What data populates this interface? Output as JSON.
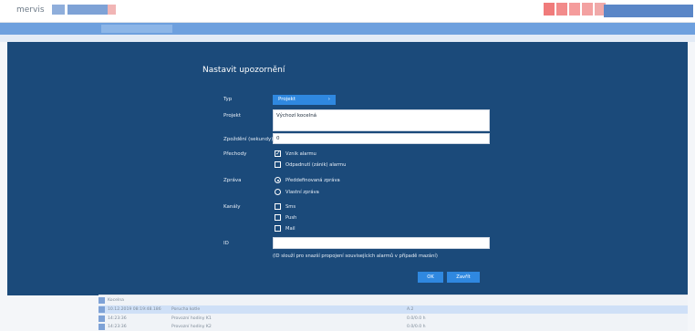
{
  "app": {
    "logo": "mervis"
  },
  "modal": {
    "title": "Nastavit upozornění",
    "fields": {
      "typ": {
        "label": "Typ",
        "value": "Projekt",
        "chevron": "›"
      },
      "projekt": {
        "label": "Projekt",
        "value": "Výchozí kocelná"
      },
      "zpozdeni": {
        "label": "Zpoždění (sekundy)",
        "value": "0"
      },
      "prechody": {
        "label": "Přechody",
        "options": [
          {
            "label": "Vznik alarmu",
            "checked": true
          },
          {
            "label": "Odpadnutí (zánik) alarmu",
            "checked": false
          }
        ]
      },
      "zprava": {
        "label": "Zpráva",
        "options": [
          {
            "label": "Předdefinovaná zpráva",
            "selected": true
          },
          {
            "label": "Vlastní zpráva",
            "selected": false
          }
        ]
      },
      "kanaly": {
        "label": "Kanály",
        "options": [
          {
            "label": "Sms",
            "checked": false
          },
          {
            "label": "Push",
            "checked": false
          },
          {
            "label": "Mail",
            "checked": false
          }
        ]
      },
      "id": {
        "label": "ID",
        "value": "",
        "note": "(ID slouží pro snazší propojení souvisejících alarmů v případě mazání)"
      }
    },
    "buttons": {
      "ok": "OK",
      "close": "Zavřít"
    }
  },
  "background_table": {
    "rows": [
      {
        "col1": "Kocelna",
        "col2": "",
        "col3": ""
      },
      {
        "col1": "10.12.2019 08:19:48.186",
        "col2": "Porucha kotle",
        "col3": "A.2"
      },
      {
        "col1": "14:23:36",
        "col2": "Provozní hodiny K1",
        "col3": "0.0/0.0 h"
      },
      {
        "col1": "14:23:36",
        "col2": "Provozní hodiny K2",
        "col3": "0.0/0.0 h"
      }
    ]
  },
  "colors": {
    "modal_bg": "#1b4a7a",
    "accent": "#2f88e0",
    "toolbar": "#6ea0de"
  },
  "icons": [
    "check-icon",
    "radio-icon",
    "chevron-right-icon"
  ]
}
